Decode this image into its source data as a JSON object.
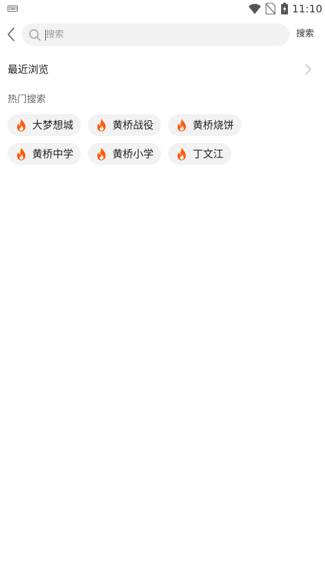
{
  "status_bar": {
    "time": "11:10"
  },
  "header": {
    "search_placeholder": "搜索",
    "search_button_label": "搜索"
  },
  "recent": {
    "label": "最近浏览"
  },
  "hot": {
    "title": "热门搜索",
    "tags": [
      {
        "label": "大梦想城"
      },
      {
        "label": "黄桥战役"
      },
      {
        "label": "黄桥烧饼"
      },
      {
        "label": "黄桥中学"
      },
      {
        "label": "黄桥小学"
      },
      {
        "label": "丁文江"
      }
    ]
  },
  "colors": {
    "flame": "#ff5a0a",
    "chip_bg": "#f2f2f2"
  }
}
